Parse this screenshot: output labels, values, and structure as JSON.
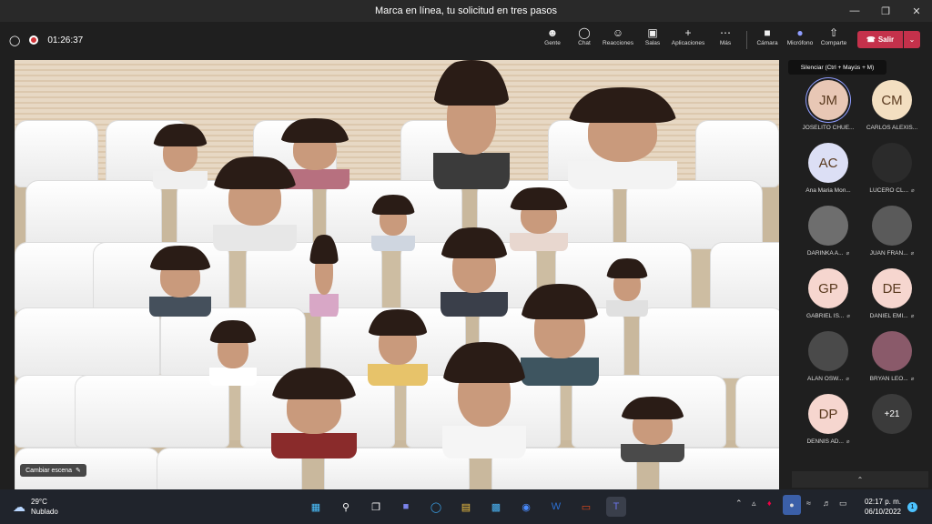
{
  "window": {
    "title": "Marca en línea, tu solicitud en tres pasos"
  },
  "meeting": {
    "timer": "01:26:37"
  },
  "toolbar": {
    "people": "Gente",
    "chat": "Chat",
    "reactions": "Reacciones",
    "rooms": "Salas",
    "apps": "Aplicaciones",
    "more": "Más",
    "camera": "Cámara",
    "mic": "Micrófono",
    "share": "Comparte",
    "leave": "Salir"
  },
  "tooltip": {
    "text": "Silenciar (Ctrl + Mayús + M)"
  },
  "stage": {
    "scene_button": "Cambiar escena"
  },
  "roster": [
    {
      "initials": "JM",
      "name": "JOSELITO CHUE...",
      "bg": "#e8c7b5",
      "photo": false,
      "muted": false,
      "speaking": true
    },
    {
      "initials": "CM",
      "name": "CARLOS ALEXIS...",
      "bg": "#f3dfc1",
      "photo": false,
      "muted": false
    },
    {
      "initials": "AC",
      "name": "Ana Maria Mon...",
      "bg": "#dcdff5",
      "photo": false,
      "muted": false
    },
    {
      "initials": "",
      "name": "LUCERO CL...",
      "bg": "#2b2b2b",
      "photo": true,
      "muted": true
    },
    {
      "initials": "",
      "name": "DARINKA A...",
      "bg": "#6e6e6e",
      "photo": true,
      "muted": true
    },
    {
      "initials": "",
      "name": "JUAN FRAN...",
      "bg": "#5a5a5a",
      "photo": true,
      "muted": true
    },
    {
      "initials": "GP",
      "name": "GABRIEL IS...",
      "bg": "#f6d6cf",
      "photo": false,
      "muted": true
    },
    {
      "initials": "DE",
      "name": "DANIEL EMI...",
      "bg": "#f6d6cf",
      "photo": false,
      "muted": true
    },
    {
      "initials": "",
      "name": "ALAN OSW...",
      "bg": "#4a4a4a",
      "photo": true,
      "muted": true
    },
    {
      "initials": "",
      "name": "BRYAN LEO...",
      "bg": "#8a5a6a",
      "photo": true,
      "muted": true
    },
    {
      "initials": "DP",
      "name": "DENNIS AD...",
      "bg": "#f6d6cf",
      "photo": false,
      "muted": true
    }
  ],
  "roster_more": "+21",
  "taskbar": {
    "temp": "29°C",
    "condition": "Nublado",
    "time": "02:17 p. m.",
    "date": "06/10/2022",
    "notifications": "1"
  },
  "colors": {
    "accent": "#8f9dff",
    "leave": "#c4314b",
    "stage_bg": "#ece6dd"
  }
}
